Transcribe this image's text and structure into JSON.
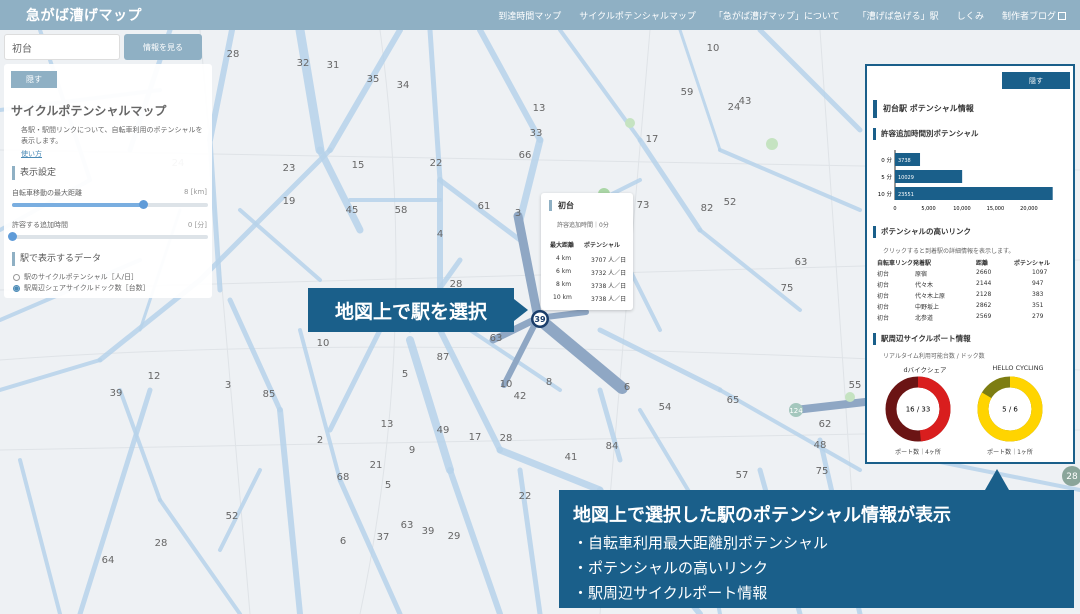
{
  "header": {
    "title": "急がば漕げマップ",
    "nav": [
      "到達時間マップ",
      "サイクルポテンシャルマップ",
      "「急がば漕げマップ」について",
      "「漕げば急げる」駅",
      "しくみ",
      "制作者ブログ"
    ]
  },
  "search": {
    "value": "初台",
    "button_label": "情報を見る"
  },
  "left_panel": {
    "hide_label": "隠す",
    "title": "サイクルポテンシャルマップ",
    "description": "各駅・駅間リンクについて、自転車利用のポテンシャルを表示します。",
    "usage_link": "使い方",
    "settings_title": "表示設定",
    "max_distance_label": "自転車移動の最大距離",
    "max_distance_value": "8 [km]",
    "max_distance_fraction": 0.67,
    "extra_time_label": "許容する追加時間",
    "extra_time_value": "0 [分]",
    "extra_time_fraction": 0.0,
    "data_title": "駅で表示するデータ",
    "radio_options": [
      "駅のサイクルポテンシャル［人/日］",
      "駅周辺シェアサイクルドック数［台数］"
    ],
    "radio_selected": 1
  },
  "popup": {
    "station": "初台",
    "extra_time": "許容追加時間｜0分",
    "col1": "最大距離",
    "col2": "ポテンシャル",
    "rows": [
      {
        "dist": "4 km",
        "value": "3707 人／日"
      },
      {
        "dist": "6 km",
        "value": "3732 人／日"
      },
      {
        "dist": "8 km",
        "value": "3738 人／日"
      },
      {
        "dist": "10 km",
        "value": "3738 人／日"
      }
    ]
  },
  "callout_select": "地図上で駅を選択",
  "callout_info": {
    "title": "地図上で選択した駅のポテンシャル情報が表示",
    "items": [
      "・自転車利用最大距離別ポテンシャル",
      "・ポテンシャルの高いリンク",
      "・駅周辺サイクルポート情報"
    ]
  },
  "right_panel": {
    "hide_label": "隠す",
    "title": "初台駅 ポテンシャル情報",
    "section1": "許容追加時間別ポテンシャル",
    "bar_chart": {
      "categories": [
        "0 分",
        "5 分",
        "10 分"
      ],
      "values": [
        3738,
        10029,
        23551
      ],
      "value_labels": [
        "3738",
        "10029",
        "23551"
      ],
      "ticks": [
        "0",
        "5,000",
        "10,000",
        "15,000",
        "20,000"
      ],
      "xlim": [
        0,
        23000
      ]
    },
    "section2": "ポテンシャルの高いリンク",
    "links_note": "クリックすると到着駅の詳細情報を表示します。",
    "links_headers": [
      "自転車リンク発着駅",
      "距離",
      "ポテンシャル"
    ],
    "links_rows": [
      [
        "初台",
        "原宿",
        "2660",
        "1097"
      ],
      [
        "初台",
        "代々木",
        "2144",
        "947"
      ],
      [
        "初台",
        "代々木上原",
        "2128",
        "383"
      ],
      [
        "初台",
        "中野坂上",
        "2862",
        "351"
      ],
      [
        "初台",
        "北参道",
        "2569",
        "279"
      ]
    ],
    "section3": "駅周辺サイクルポート情報",
    "ports_note": "リアルタイム利用可能台数 / ドック数",
    "ports": [
      {
        "name": "dバイクシェア",
        "available": 16,
        "docks": 33,
        "label": "16 / 33",
        "footer": "ポート数｜4ヶ所",
        "color_used": "#d91e1e",
        "color_free": "#6b1414"
      },
      {
        "name": "HELLO CYCLING",
        "available": 5,
        "docks": 6,
        "label": "5 / 6",
        "footer": "ポート数｜1ヶ所",
        "color_used": "#ffd400",
        "color_free": "#7d7d12"
      }
    ]
  },
  "map_labels": [
    [
      "28",
      233,
      57
    ],
    [
      "32",
      303,
      66
    ],
    [
      "31",
      333,
      68
    ],
    [
      "35",
      373,
      82
    ],
    [
      "34",
      403,
      88
    ],
    [
      "13",
      539,
      111
    ],
    [
      "33",
      536,
      136
    ],
    [
      "66",
      525,
      158
    ],
    [
      "17",
      652,
      142
    ],
    [
      "59",
      687,
      95
    ],
    [
      "10",
      713,
      51
    ],
    [
      "24",
      734,
      110
    ],
    [
      "43",
      745,
      104
    ],
    [
      "22",
      436,
      166
    ],
    [
      "23",
      289,
      171
    ],
    [
      "24",
      178,
      166
    ],
    [
      "15",
      358,
      168
    ],
    [
      "61",
      484,
      209
    ],
    [
      "73",
      643,
      208
    ],
    [
      "82",
      707,
      211
    ],
    [
      "52",
      730,
      205
    ],
    [
      "63",
      801,
      265
    ],
    [
      "75",
      787,
      291
    ],
    [
      "19",
      289,
      204
    ],
    [
      "45",
      352,
      213
    ],
    [
      "58",
      401,
      213
    ],
    [
      "3",
      518,
      216
    ],
    [
      "4",
      440,
      237
    ],
    [
      "17",
      440,
      305
    ],
    [
      "28",
      456,
      287
    ],
    [
      "63",
      496,
      341
    ],
    [
      "39",
      539,
      320
    ],
    [
      "3",
      472,
      327
    ],
    [
      "8",
      549,
      385
    ],
    [
      "6",
      627,
      390
    ],
    [
      "54",
      665,
      410
    ],
    [
      "65",
      733,
      403
    ],
    [
      "12",
      154,
      379
    ],
    [
      "3",
      228,
      388
    ],
    [
      "39",
      116,
      396
    ],
    [
      "85",
      269,
      397
    ],
    [
      "87",
      443,
      360
    ],
    [
      "5",
      405,
      377
    ],
    [
      "10",
      323,
      346
    ],
    [
      "10",
      506,
      387
    ],
    [
      "42",
      520,
      399
    ],
    [
      "13",
      387,
      427
    ],
    [
      "49",
      443,
      433
    ],
    [
      "17",
      475,
      440
    ],
    [
      "28",
      506,
      441
    ],
    [
      "41",
      571,
      460
    ],
    [
      "84",
      612,
      449
    ],
    [
      "2",
      320,
      443
    ],
    [
      "21",
      376,
      468
    ],
    [
      "9",
      412,
      453
    ],
    [
      "68",
      343,
      480
    ],
    [
      "5",
      388,
      488
    ],
    [
      "52",
      232,
      519
    ],
    [
      "28",
      161,
      546
    ],
    [
      "63",
      407,
      528
    ],
    [
      "39",
      428,
      534
    ],
    [
      "29",
      454,
      539
    ],
    [
      "37",
      383,
      540
    ],
    [
      "6",
      343,
      544
    ],
    [
      "64",
      108,
      563
    ],
    [
      "22",
      525,
      499
    ],
    [
      "62",
      825,
      427
    ],
    [
      "75",
      822,
      474
    ],
    [
      "48",
      820,
      448
    ],
    [
      "57",
      742,
      478
    ],
    [
      "55",
      855,
      388
    ]
  ]
}
